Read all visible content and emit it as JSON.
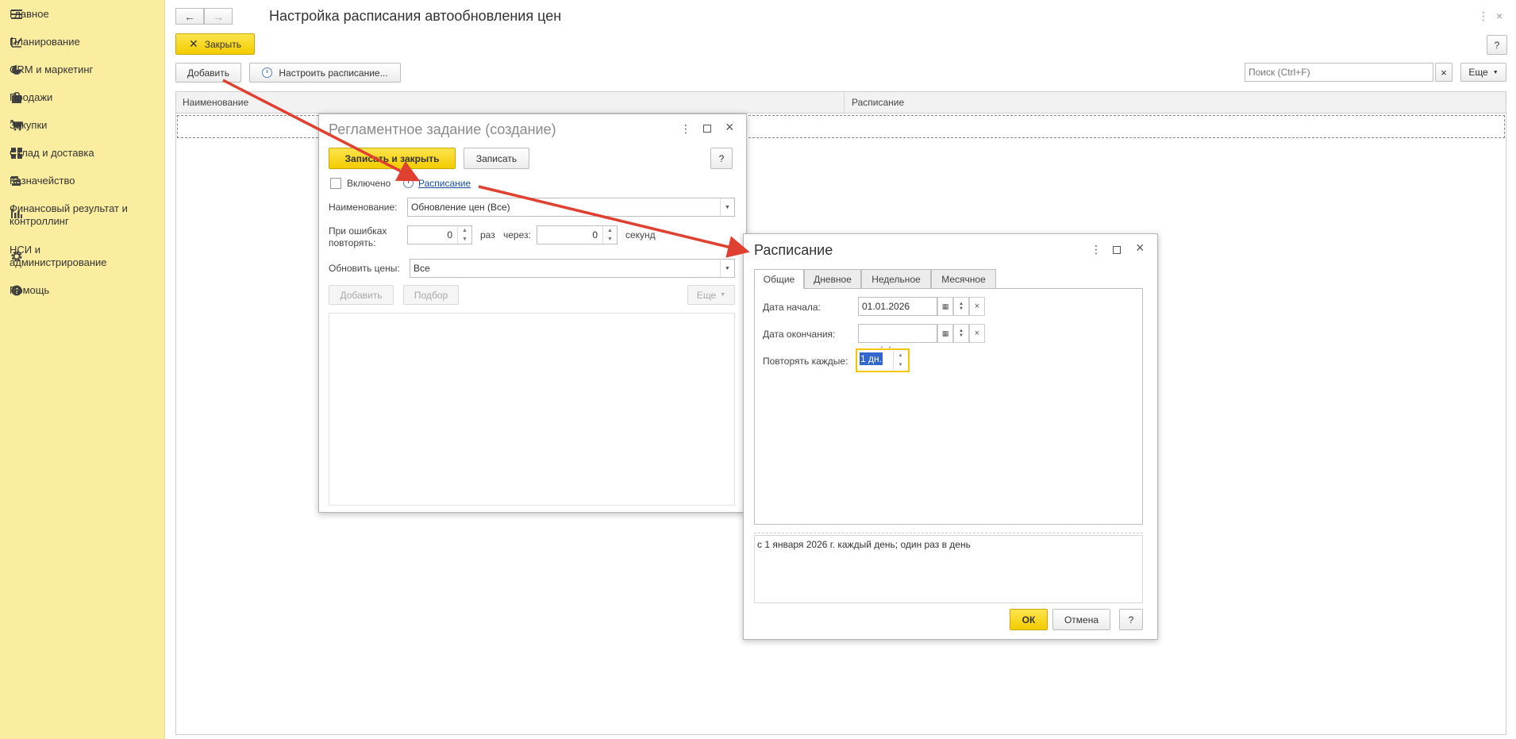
{
  "sidebar": {
    "items": [
      {
        "label": "Главное",
        "icon": "menu-icon"
      },
      {
        "label": "Планирование",
        "icon": "planning-icon"
      },
      {
        "label": "CRM и маркетинг",
        "icon": "pie-chart-icon"
      },
      {
        "label": "Продажи",
        "icon": "bag-icon"
      },
      {
        "label": "Закупки",
        "icon": "cart-icon"
      },
      {
        "label": "Склад и доставка",
        "icon": "grid-icon"
      },
      {
        "label": "Казначейство",
        "icon": "treasury-icon"
      },
      {
        "label": "Финансовый результат и контроллинг",
        "icon": "bar-chart-icon"
      },
      {
        "label": "НСИ и администрирование",
        "icon": "gear-icon"
      },
      {
        "label": "Помощь",
        "icon": "help-icon"
      }
    ]
  },
  "header": {
    "title": "Настройка расписания автообновления цен",
    "close_label": "Закрыть",
    "help_label": "?"
  },
  "toolbar": {
    "add_label": "Добавить",
    "schedule_label": "Настроить расписание...",
    "search_placeholder": "Поиск (Ctrl+F)",
    "search_clear": "×",
    "more_label": "Еще"
  },
  "table": {
    "columns": [
      "Наименование",
      "Расписание"
    ]
  },
  "task_dialog": {
    "title": "Регламентное задание (создание)",
    "save_close_label": "Записать и закрыть",
    "save_label": "Записать",
    "help_label": "?",
    "enabled_label": "Включено",
    "enabled_checked": false,
    "schedule_link": "Расписание",
    "name_label": "Наименование:",
    "name_value": "Обновление цен (Все)",
    "retry_label_1": "При ошибках",
    "retry_label_2": "повторять:",
    "retry_count": "0",
    "times_label": "раз",
    "via_label": "через:",
    "retry_interval": "0",
    "seconds_label": "секунд",
    "update_prices_label": "Обновить цены:",
    "update_prices_value": "Все",
    "add_label": "Добавить",
    "pick_label": "Подбор",
    "more_label": "Еще"
  },
  "schedule_dialog": {
    "title": "Расписание",
    "tabs": [
      "Общие",
      "Дневное",
      "Недельное",
      "Месячное"
    ],
    "active_tab": "Общие",
    "start_date_label": "Дата начала:",
    "start_date_value": "01.01.2026",
    "end_date_label": "Дата окончания:",
    "end_date_value": " .  .",
    "repeat_label": "Повторять каждые:",
    "repeat_value": "1 дн.",
    "summary": "с 1 января 2026 г. каждый день; один раз в день",
    "ok_label": "ОК",
    "cancel_label": "Отмена",
    "help_label": "?"
  },
  "colors": {
    "sidebar_bg": "#fbeda0",
    "accent_yellow": "#f5d10a",
    "annotation_arrow": "#e0402f",
    "link_blue": "#1a4ea0"
  }
}
